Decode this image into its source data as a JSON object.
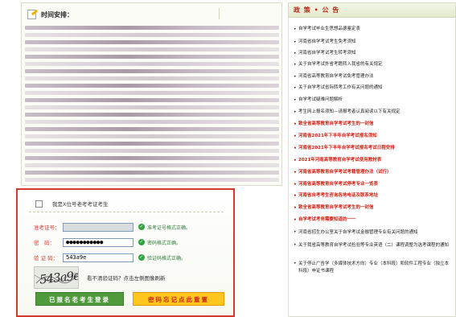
{
  "schedule": {
    "title": "时间安排："
  },
  "login": {
    "checkbox_label": "我是X位号老考考证考生",
    "fields": [
      {
        "label": "准考证号：",
        "value": "",
        "ok": "准考证号格式正确。",
        "masked": true
      },
      {
        "label": "密　码：",
        "value": "●●●●●●●●●●●",
        "ok": "密码格式正确。",
        "masked": false
      },
      {
        "label": "验 证 码：",
        "value": "543a9e",
        "ok": "验证码格式正确。",
        "masked": false
      }
    ],
    "captcha_text": "543a9e",
    "captcha_tip": "看不清验证码？点击左侧图像刷新",
    "submit_label": "已报名老考生登录",
    "reset_label": "密码忘记点此重置"
  },
  "news": {
    "title": "政 策 • 公 告",
    "items": [
      {
        "text": "自学考试毕业生思想品德鉴定表",
        "red": false
      },
      {
        "text": "河南省自学考试考生免考须知",
        "red": false
      },
      {
        "text": "河南省自学考试考生转考须知",
        "red": false
      },
      {
        "text": "关于自学考试外省考籍转入我省的有关规定",
        "red": false
      },
      {
        "text": "河南省高等教育自学考试免考管理办法",
        "red": false
      },
      {
        "text": "关于自学考试省际转考工作有关问题的通知",
        "red": false
      },
      {
        "text": "自学考试疑难问题解析",
        "red": false
      },
      {
        "text": "考生网上报名须知—请报考者认真阅读以下有关规定",
        "red": false
      },
      {
        "text": "致全省高等教育自学考试考生的一封信",
        "red": true
      },
      {
        "text": "河南省2021年下半年自学考试报名须知",
        "red": true
      },
      {
        "text": "河南省2021年下半年自学考试报名考试日程安排",
        "red": true
      },
      {
        "text": "2021年河南高等教育自学考试使用教材表",
        "red": true
      },
      {
        "text": "河南省高等教育自学考试考籍管理办法（试行）",
        "red": true
      },
      {
        "text": "河南省高等教育自学考试停考专业一览表",
        "red": true
      },
      {
        "text": "河南省自考考生咨询各地电话及联系地址",
        "red": true
      },
      {
        "text": "致全省高等教育自学考试考生的一封信",
        "red": true
      },
      {
        "text": "自学考试考务需要知道的一一",
        "red": true
      },
      {
        "text": "河南省招生办公室关于自学考试金融管理专业有关问题的通知",
        "red": false
      },
      {
        "text": "关于我省高等教育自学考试检验等专业英语（二）课程调整为选考课程的通知",
        "red": false
      },
      {
        "text": "关于停止广告学（多媒体技术方向）专业（本科段）和软件工程专业（独立本科段）申证书课程",
        "red": false
      }
    ]
  }
}
